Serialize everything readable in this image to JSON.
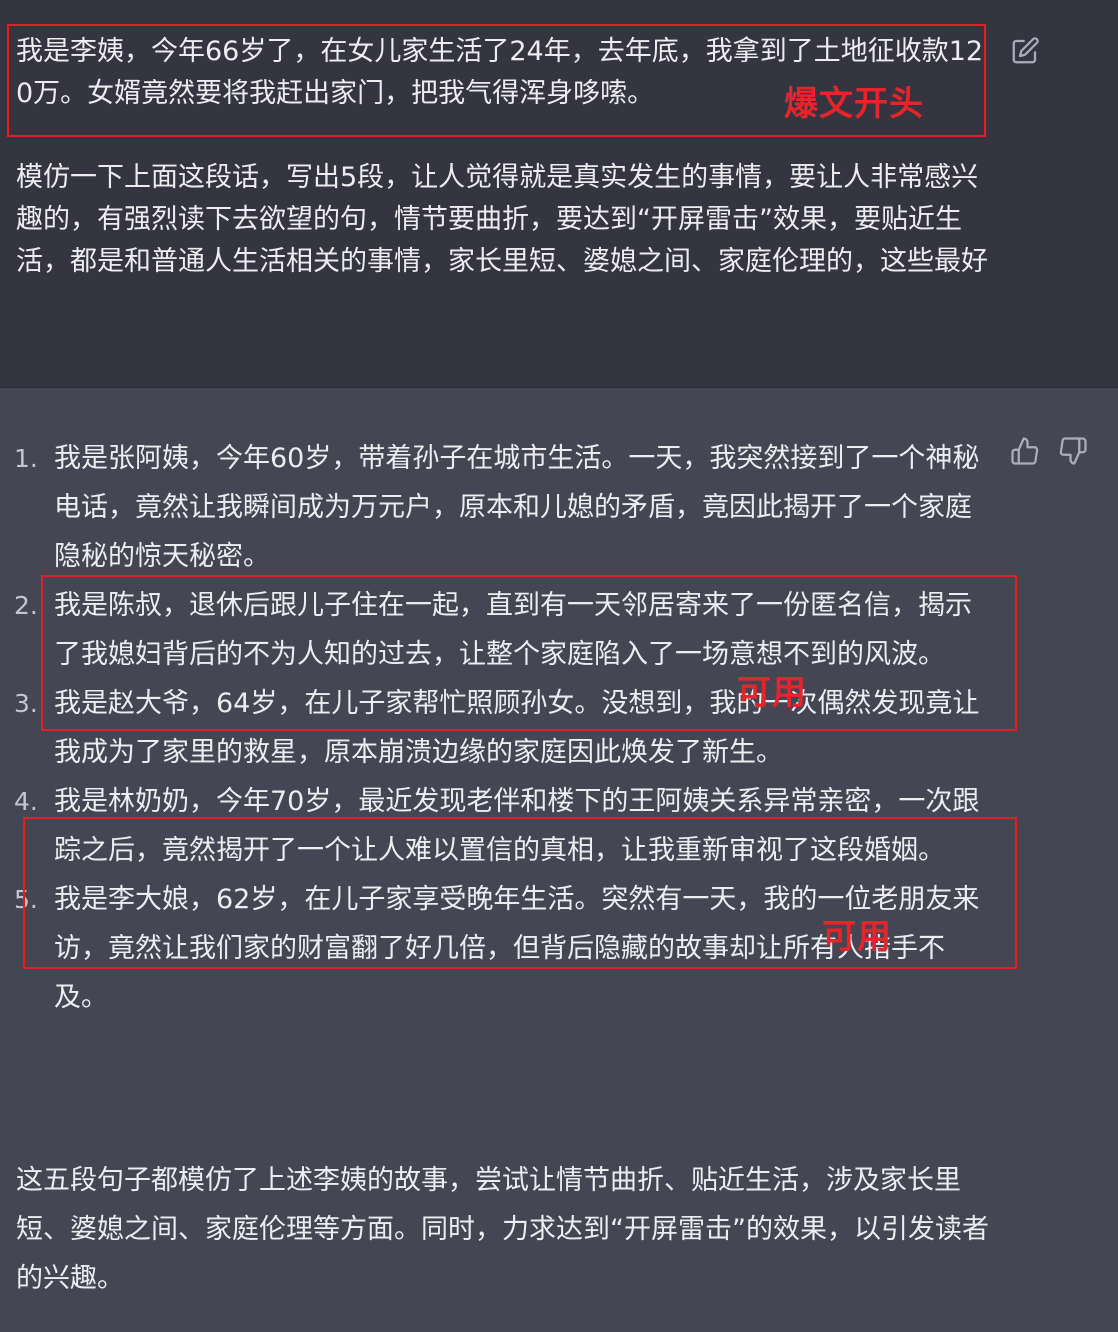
{
  "user_message": {
    "paragraph1": "我是李姨，今年66岁了，在女儿家生活了24年，去年底，我拿到了土地征收款120万。女婿竟然要将我赶出家门，把我气得浑身哆嗦。",
    "paragraph2": "模仿一下上面这段话，写出5段，让人觉得就是真实发生的事情，要让人非常感兴趣的，有强烈读下去欲望的句，情节要曲折，要达到“开屏雷击”效果，要贴近生活，都是和普通人生活相关的事情，家长里短、婆媳之间、家庭伦理的，这些最好"
  },
  "assistant_message": {
    "items": [
      {
        "num": "1.",
        "text": "我是张阿姨，今年60岁，带着孙子在城市生活。一天，我突然接到了一个神秘电话，竟然让我瞬间成为万元户，原本和儿媳的矛盾，竟因此揭开了一个家庭隐秘的惊天秘密。"
      },
      {
        "num": "2.",
        "text": "我是陈叔，退休后跟儿子住在一起，直到有一天邻居寄来了一份匿名信，揭示了我媳妇背后的不为人知的过去，让整个家庭陷入了一场意想不到的风波。"
      },
      {
        "num": "3.",
        "text": "我是赵大爷，64岁，在儿子家帮忙照顾孙女。没想到，我的一次偶然发现竟让我成为了家里的救星，原本崩溃边缘的家庭因此焕发了新生。"
      },
      {
        "num": "4.",
        "text": "我是林奶奶，今年70岁，最近发现老伴和楼下的王阿姨关系异常亲密，一次跟踪之后，竟然揭开了一个让人难以置信的真相，让我重新审视了这段婚姻。"
      },
      {
        "num": "5.",
        "text": "我是李大娘，62岁，在儿子家享受晚年生活。突然有一天，我的一位老朋友来访，竟然让我们家的财富翻了好几倍，但背后隐藏的故事却让所有人措手不及。"
      }
    ],
    "summary": "这五段句子都模仿了上述李姨的故事，尝试让情节曲折、贴近生活，涉及家长里短、婆媳之间、家庭伦理等方面。同时，力求达到“开屏雷击”的效果，以引发读者的兴趣。"
  },
  "annotations": {
    "label_opening": "爆文开头",
    "label_usable_1": "可用",
    "label_usable_2": "可用",
    "color": "#e01e24"
  },
  "icons": {
    "edit": "edit-icon",
    "thumbs_up": "thumbs-up-icon",
    "thumbs_down": "thumbs-down-icon"
  }
}
